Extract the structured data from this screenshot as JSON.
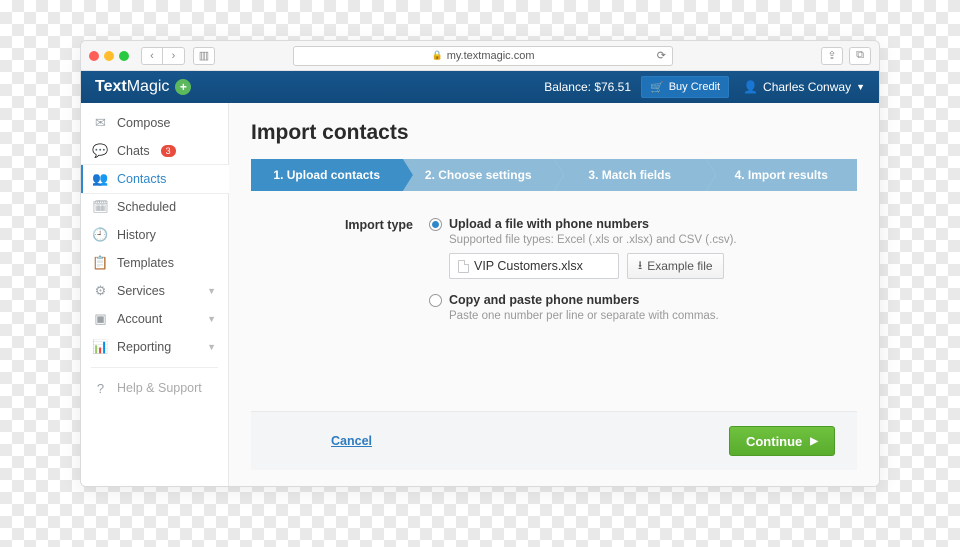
{
  "browser": {
    "url": "my.textmagic.com"
  },
  "header": {
    "brand1": "Text",
    "brand2": "Magic",
    "balance_label": "Balance:",
    "balance_value": "$76.51",
    "buy_credit": "Buy Credit",
    "user_name": "Charles Conway"
  },
  "sidebar": {
    "items": [
      {
        "label": "Compose"
      },
      {
        "label": "Chats",
        "badge": "3"
      },
      {
        "label": "Contacts"
      },
      {
        "label": "Scheduled"
      },
      {
        "label": "History"
      },
      {
        "label": "Templates"
      },
      {
        "label": "Services"
      },
      {
        "label": "Account"
      },
      {
        "label": "Reporting"
      }
    ],
    "help": "Help & Support"
  },
  "page": {
    "title": "Import contacts",
    "steps": [
      "1. Upload contacts",
      "2. Choose settings",
      "3. Match fields",
      "4. Import results"
    ],
    "import_type_label": "Import type",
    "opt1_label": "Upload a file with phone numbers",
    "opt1_hint": "Supported file types: Excel (.xls or .xlsx) and CSV (.csv).",
    "file_name": "VIP Customers.xlsx",
    "example_btn": "Example file",
    "opt2_label": "Copy and paste phone numbers",
    "opt2_hint": "Paste one number per line or separate with commas.",
    "cancel": "Cancel",
    "continue": "Continue"
  }
}
